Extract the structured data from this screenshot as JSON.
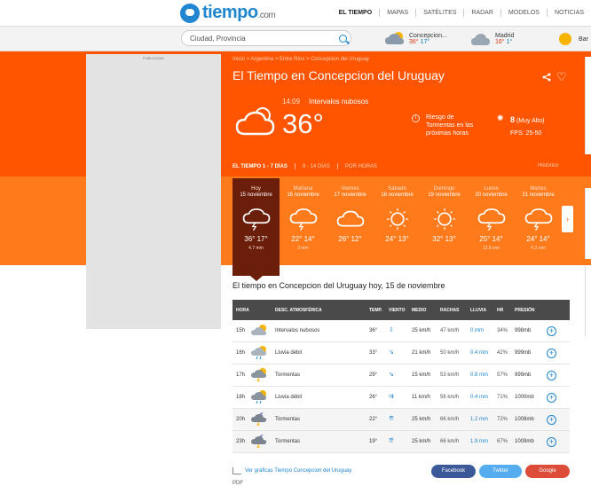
{
  "header": {
    "logo": "tiempo",
    "logo_suffix": ".com",
    "nav": [
      "EL TIEMPO",
      "MAPAS",
      "SATÉLITES",
      "RADAR",
      "MODELOS",
      "NOTICIAS"
    ]
  },
  "search": {
    "placeholder": "Ciudad, Provincia"
  },
  "cities": [
    {
      "name": "Concepcion...",
      "max": "36°",
      "min": "17°"
    },
    {
      "name": "Madrid",
      "max": "16°",
      "min": "1°"
    },
    {
      "name": "Bar",
      "max": "",
      "min": ""
    }
  ],
  "ad_label": "PUBLICIDAD",
  "breadcrumb": "Inicio > Argentina > Entre Ríos > Concepcion del Uruguay",
  "page_title": "El Tiempo en Concepcion del Uruguay",
  "now": {
    "time": "14:09",
    "description": "Intervalos nubosos",
    "temperature": "36°",
    "risk": "Riesgo de Tormentas en las próximas horas",
    "uv_value": "8",
    "uv_label": "(Muy Alto)",
    "fps": "FPS: 25-50",
    "icon": "sun-cloud-icon"
  },
  "subtabs": [
    "EL TIEMPO 1 - 7 DÍAS",
    "8 - 14 DÍAS",
    "POR HORAS"
  ],
  "historico": "Histórico",
  "days": [
    {
      "name": "Hoy",
      "date": "15 noviembre",
      "temps": "36° 17°",
      "rain": "4.7 mm",
      "icon": "storm-icon"
    },
    {
      "name": "Mañana",
      "date": "16 noviembre",
      "temps": "22° 14°",
      "rain": "3 mm",
      "icon": "storm-icon"
    },
    {
      "name": "Viernes",
      "date": "17 noviembre",
      "temps": "26° 12°",
      "rain": "",
      "icon": "cloud-icon"
    },
    {
      "name": "Sábado",
      "date": "18 noviembre",
      "temps": "24° 13°",
      "rain": "",
      "icon": "sun-icon"
    },
    {
      "name": "Domingo",
      "date": "19 noviembre",
      "temps": "32° 13°",
      "rain": "",
      "icon": "sun-icon"
    },
    {
      "name": "Lunes",
      "date": "20 noviembre",
      "temps": "25° 14°",
      "rain": "13.8 mm",
      "icon": "storm-icon"
    },
    {
      "name": "Martes",
      "date": "21 noviembre",
      "temps": "24° 14°",
      "rain": "4.3 mm",
      "icon": "storm-icon"
    }
  ],
  "section_title": "El tiempo en Concepcion del Uruguay hoy, 15 de noviembre",
  "table": {
    "headers": [
      "HORA",
      "DESC. ATMOSFÉRICA",
      "TEMP.",
      "VIENTO",
      "MEDIO",
      "RACHAS",
      "LLUVIA",
      "HR",
      "PRESIÓN"
    ],
    "rows": [
      {
        "hour": "15h",
        "desc": "Intervalos nubosos",
        "temp": "36°",
        "wind": "25 km/h",
        "gust": "47 km/h",
        "rain": "0 mm",
        "hr": "34%",
        "pres": "998mb",
        "night": false
      },
      {
        "hour": "16h",
        "desc": "Lluvia débil",
        "temp": "33°",
        "wind": "21 km/h",
        "gust": "50 km/h",
        "rain": "0.4 mm",
        "hr": "42%",
        "pres": "999mb",
        "night": false
      },
      {
        "hour": "17h",
        "desc": "Tormentas",
        "temp": "29°",
        "wind": "15 km/h",
        "gust": "53 km/h",
        "rain": "0.8 mm",
        "hr": "57%",
        "pres": "999mb",
        "night": false
      },
      {
        "hour": "18h",
        "desc": "Lluvia débil",
        "temp": "26°",
        "wind": "11 km/h",
        "gust": "56 km/h",
        "rain": "0.4 mm",
        "hr": "71%",
        "pres": "1000mb",
        "night": false
      },
      {
        "hour": "20h",
        "desc": "Tormentas",
        "temp": "22°",
        "wind": "25 km/h",
        "gust": "66 km/h",
        "rain": "1.2 mm",
        "hr": "72%",
        "pres": "1008mb",
        "night": true
      },
      {
        "hour": "23h",
        "desc": "Tormentas",
        "temp": "19°",
        "wind": "25 km/h",
        "gust": "66 km/h",
        "rain": "1.9 mm",
        "hr": "67%",
        "pres": "1009mb",
        "night": true
      }
    ]
  },
  "footer": {
    "chart_link": "Ver gráficas Tiempo Concepcion del Uruguay",
    "facebook": "Facebook",
    "twitter": "Twitter",
    "google": "Google",
    "pdf": "PDF"
  },
  "colors": {
    "accent": "#ff5400",
    "band": "#ff7a1a",
    "brand": "#1f86cf",
    "today": "#6b1e0a"
  }
}
